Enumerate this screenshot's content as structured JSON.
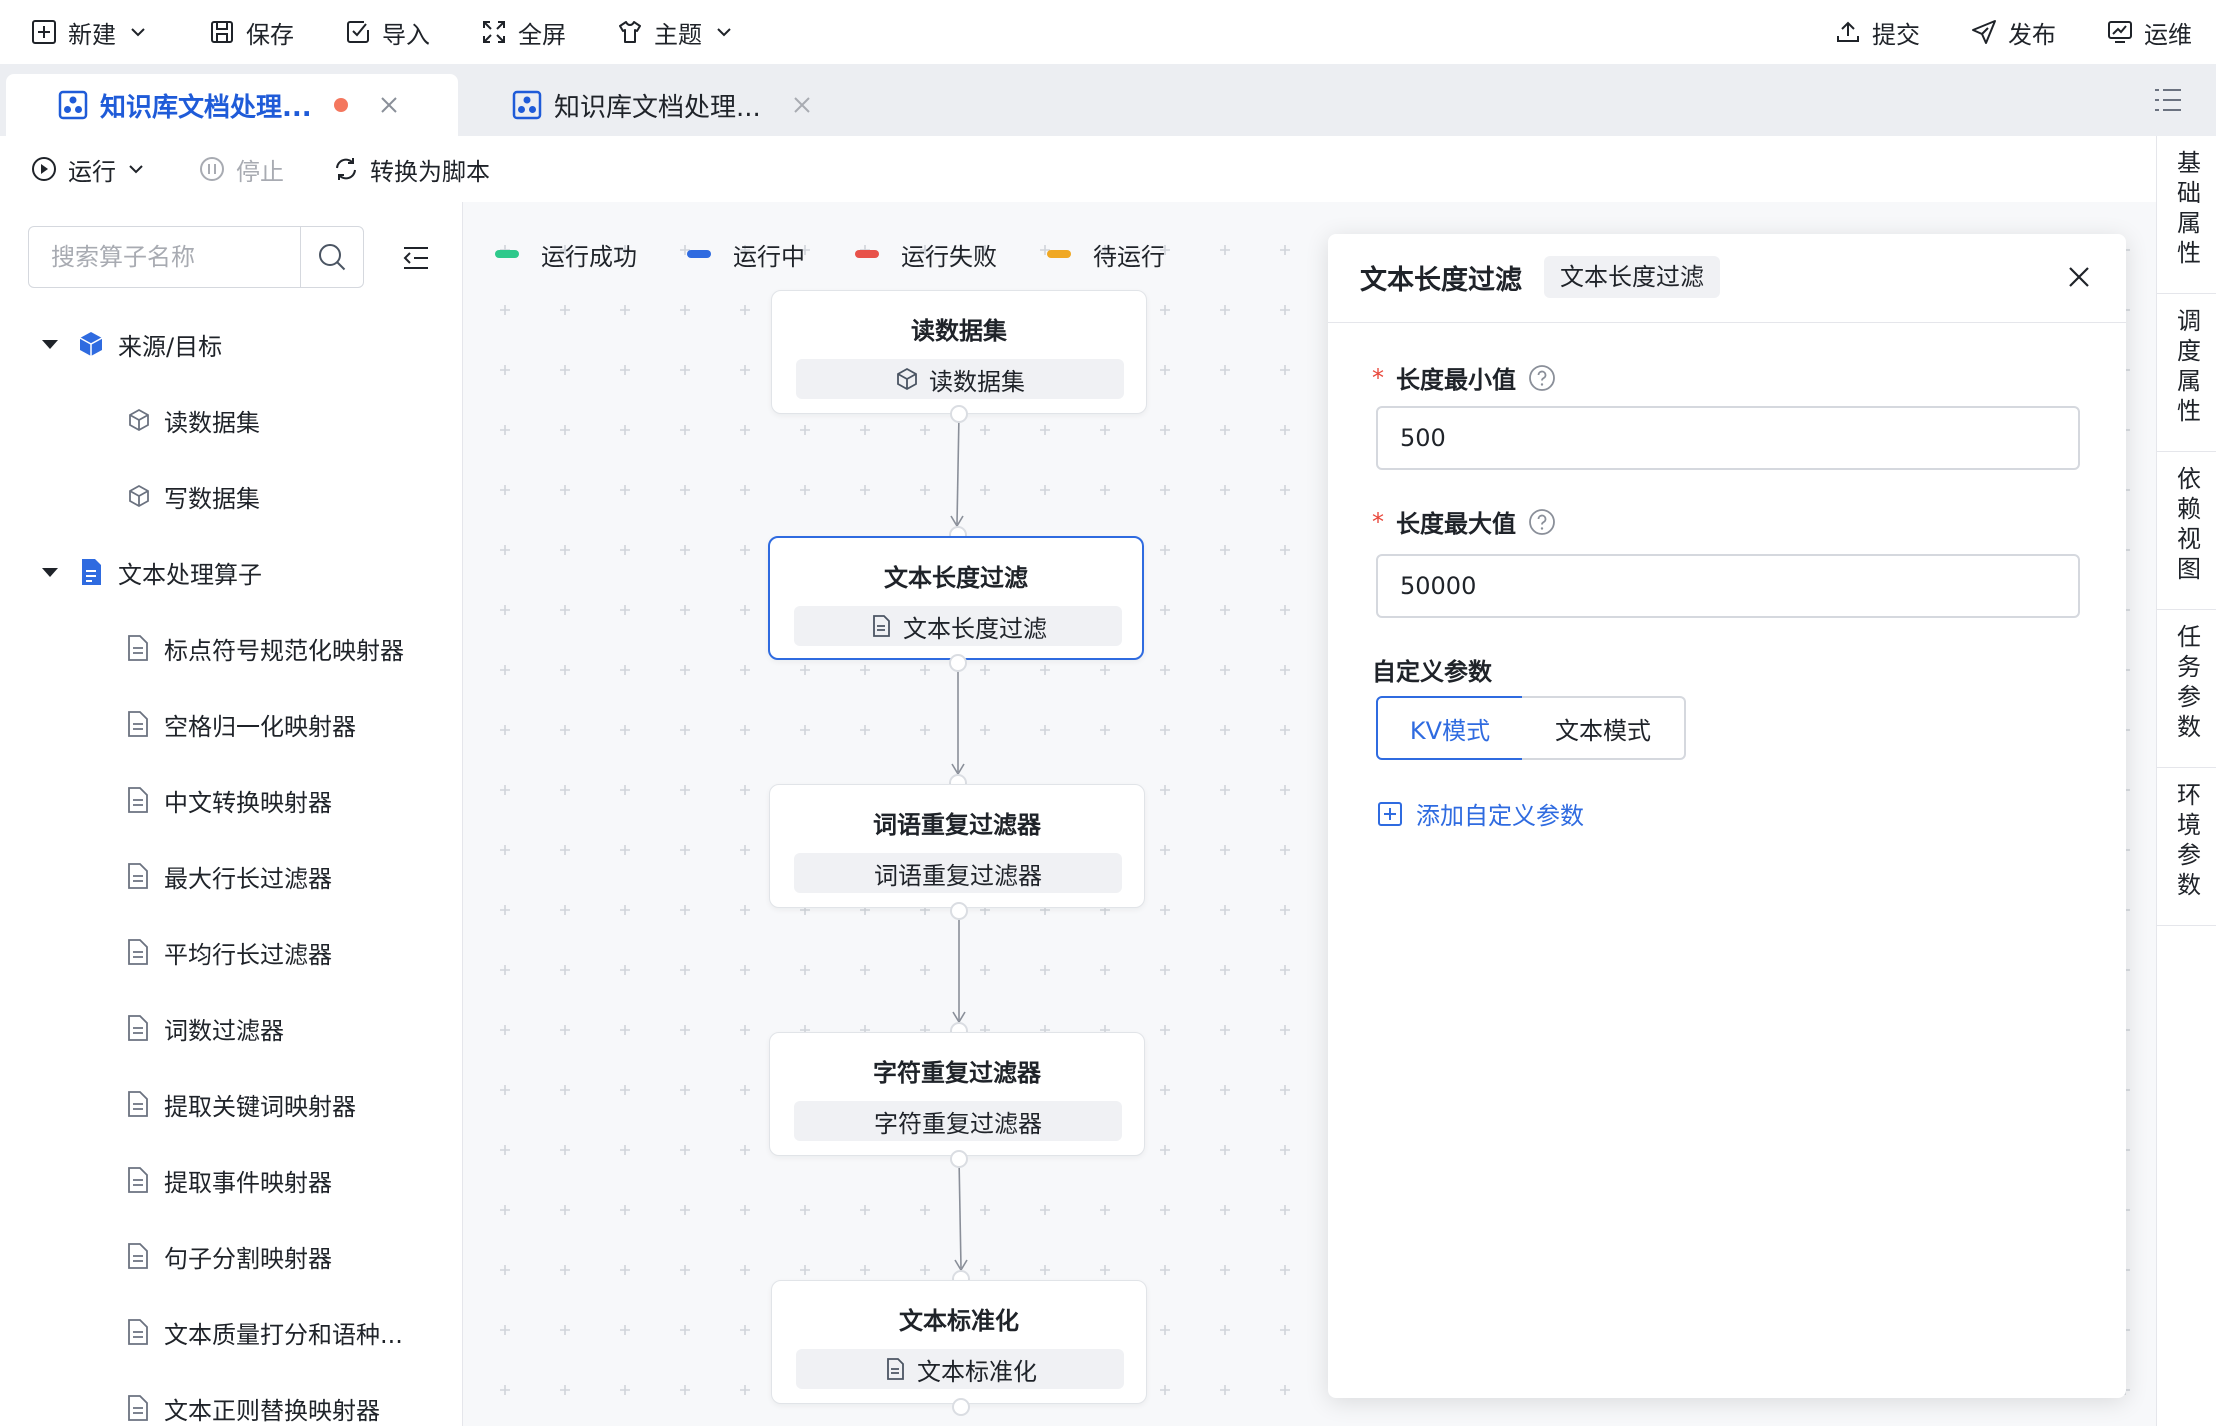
{
  "toolbar": {
    "new_label": "新建",
    "save_label": "保存",
    "import_label": "导入",
    "fullscreen_label": "全屏",
    "theme_label": "主题",
    "submit_label": "提交",
    "publish_label": "发布",
    "ops_label": "运维"
  },
  "tabs": [
    {
      "label": "知识库文档处理..."
    },
    {
      "label": "知识库文档处理..."
    }
  ],
  "runbar": {
    "run_label": "运行",
    "stop_label": "停止",
    "convert_label": "转换为脚本"
  },
  "sidebar": {
    "search_placeholder": "搜索算子名称",
    "groups": [
      {
        "label": "来源/目标",
        "items": [
          "读数据集",
          "写数据集"
        ]
      },
      {
        "label": "文本处理算子",
        "items": [
          "标点符号规范化映射器",
          "空格归一化映射器",
          "中文转换映射器",
          "最大行长过滤器",
          "平均行长过滤器",
          "词数过滤器",
          "提取关键词映射器",
          "提取事件映射器",
          "句子分割映射器",
          "文本质量打分和语种...",
          "文本正则替换映射器"
        ]
      }
    ]
  },
  "legend": {
    "success": "运行成功",
    "running": "运行中",
    "failed": "运行失败",
    "pending": "待运行"
  },
  "colors": {
    "accent": "#2f6be0",
    "success": "#2ec98b",
    "running": "#2f6be0",
    "failed": "#e8524a",
    "pending": "#f0a823",
    "unsaved_dot": "#f4775e"
  },
  "nodes": [
    {
      "title": "读数据集",
      "chip": "读数据集",
      "icon": "cube-icon"
    },
    {
      "title": "文本长度过滤",
      "chip": "文本长度过滤",
      "icon": "doc-icon"
    },
    {
      "title": "词语重复过滤器",
      "chip": "词语重复过滤器",
      "icon": ""
    },
    {
      "title": "字符重复过滤器",
      "chip": "字符重复过滤器",
      "icon": ""
    },
    {
      "title": "文本标准化",
      "chip": "文本标准化",
      "icon": "doc-icon"
    }
  ],
  "drawer": {
    "title": "文本长度过滤",
    "tag": "文本长度过滤",
    "min_label": "长度最小值",
    "min_value": "500",
    "max_label": "长度最大值",
    "max_value": "50000",
    "custom_label": "自定义参数",
    "mode_kv": "KV模式",
    "mode_text": "文本模式",
    "add_param": "添加自定义参数"
  },
  "right_tabs": [
    "基础属性",
    "调度属性",
    "依赖视图",
    "任务参数",
    "环境参数"
  ]
}
